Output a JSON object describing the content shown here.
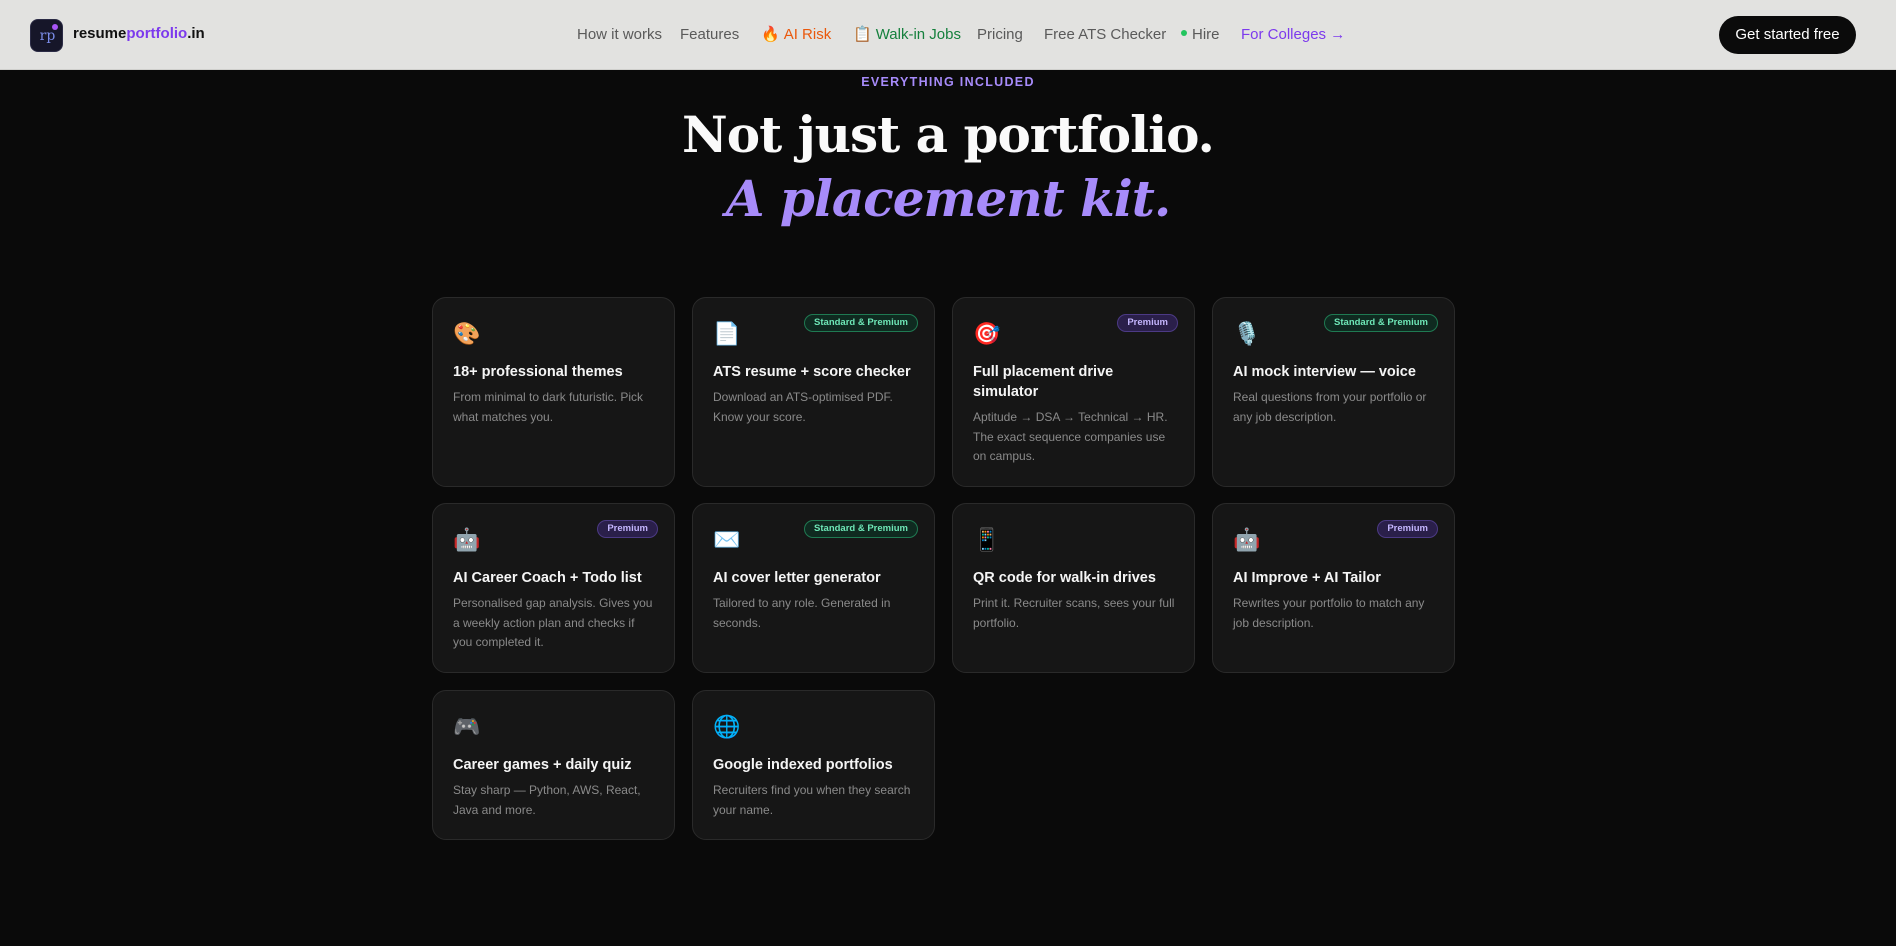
{
  "nav": {
    "brand_prefix": "resume",
    "brand_accent": "portfolio",
    "brand_suffix": ".in",
    "logo_text": "rp",
    "links": {
      "how": "How it works",
      "features": "Features",
      "ai_risk_icon": "🔥",
      "ai_risk": "AI Risk",
      "jobs_icon": "📋",
      "jobs": "Walk-in Jobs",
      "pricing": "Pricing",
      "ats": "Free ATS Checker",
      "hire": "Hire",
      "colleges": "For Colleges →"
    },
    "cta": "Get started free"
  },
  "hero": {
    "eyebrow": "EVERYTHING INCLUDED",
    "title_line1": "Not just a portfolio.",
    "title_line2": "A placement kit."
  },
  "features": [
    {
      "icon": "🎨",
      "icon_name": "palette-icon",
      "badge": "",
      "title": "18+ professional themes",
      "desc": "From minimal to dark futuristic. Pick what matches you."
    },
    {
      "icon": "📄",
      "icon_name": "document-icon",
      "badge": "Standard & Premium",
      "title": "ATS resume + score checker",
      "desc": "Download an ATS-optimised PDF. Know your score."
    },
    {
      "icon": "🎯",
      "icon_name": "target-icon",
      "badge": "Premium",
      "title": "Full placement drive simulator",
      "desc": "Aptitude → DSA → Technical → HR. The exact sequence companies use on campus."
    },
    {
      "icon": "🎙️",
      "icon_name": "microphone-icon",
      "badge": "Standard & Premium",
      "title": "AI mock interview — voice",
      "desc": "Real questions from your portfolio or any job description."
    },
    {
      "icon": "🤖",
      "icon_name": "robot-icon",
      "badge": "Premium",
      "title": "AI Career Coach + Todo list",
      "desc": "Personalised gap analysis. Gives you a weekly action plan and checks if you completed it."
    },
    {
      "icon": "✉️",
      "icon_name": "envelope-icon",
      "badge": "Standard & Premium",
      "title": "AI cover letter generator",
      "desc": "Tailored to any role. Generated in seconds."
    },
    {
      "icon": "📱",
      "icon_name": "phone-icon",
      "badge": "",
      "title": "QR code for walk-in drives",
      "desc": "Print it. Recruiter scans, sees your full portfolio."
    },
    {
      "icon": "🤖",
      "icon_name": "robot-icon",
      "badge": "Premium",
      "title": "AI Improve + AI Tailor",
      "desc": "Rewrites your portfolio to match any job description."
    },
    {
      "icon": "🎮",
      "icon_name": "gamepad-icon",
      "badge": "",
      "title": "Career games + daily quiz",
      "desc": "Stay sharp — Python, AWS, React, Java and more."
    },
    {
      "icon": "🌐",
      "icon_name": "globe-icon",
      "badge": "",
      "title": "Google indexed portfolios",
      "desc": "Recruiters find you when they search your name."
    }
  ]
}
